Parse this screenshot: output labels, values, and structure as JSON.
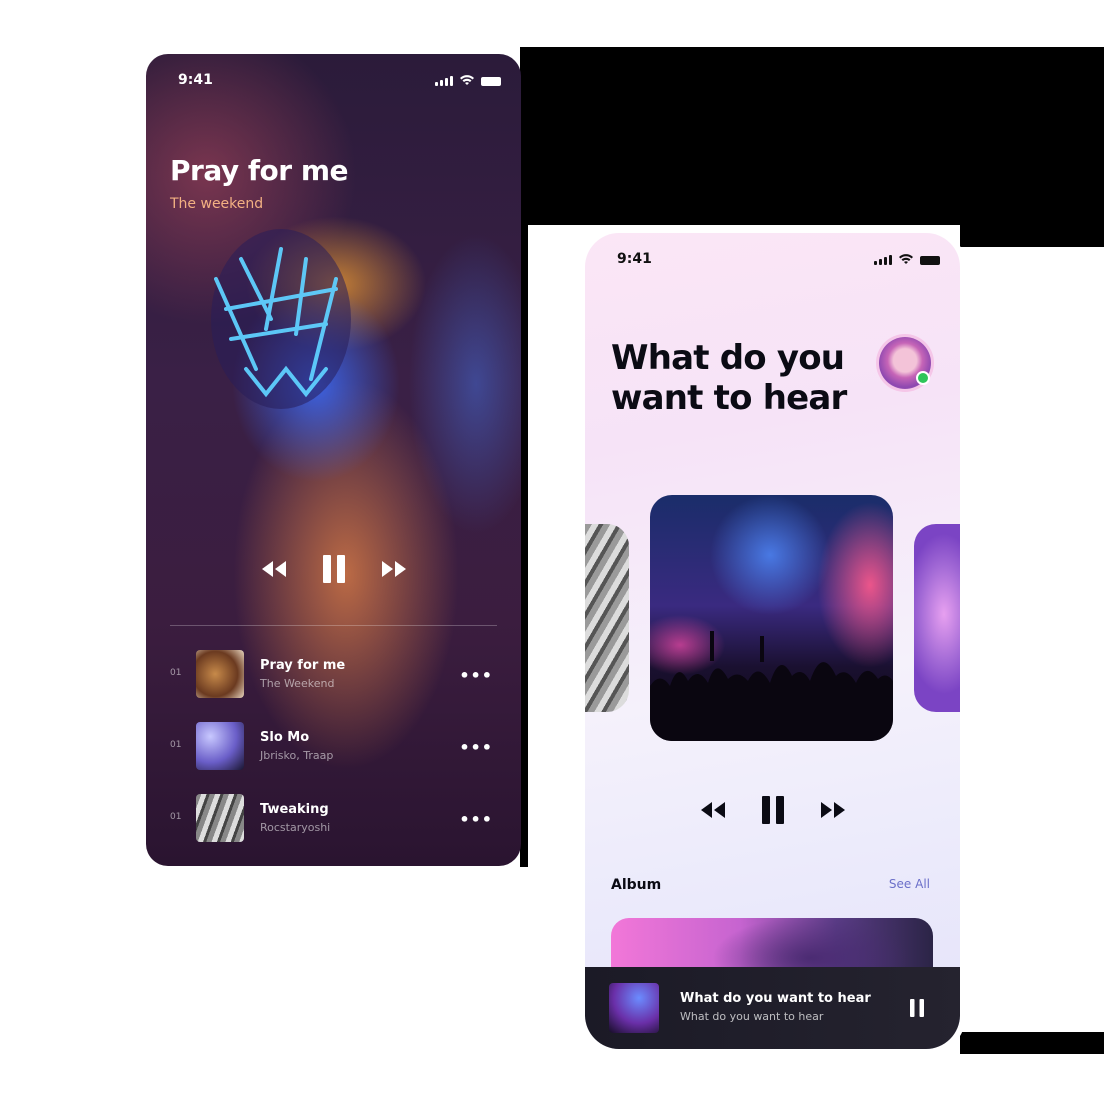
{
  "left_phone": {
    "status_time": "9:41",
    "title": "Pray for me",
    "subtitle": "The weekend",
    "tracks": [
      {
        "num": "01",
        "name": "Pray for me",
        "artist": "The Weekend",
        "more": "•••"
      },
      {
        "num": "01",
        "name": "Slo Mo",
        "artist": "Jbrisko, Traap",
        "more": "•••"
      },
      {
        "num": "01",
        "name": "Tweaking",
        "artist": "Rocstaryoshi",
        "more": "•••"
      }
    ]
  },
  "right_phone": {
    "status_time": "9:41",
    "headline": "What do you want to hear",
    "section_label": "Album",
    "see_all": "See All",
    "mini_player": {
      "title": "What do you want to hear",
      "subtitle": "What do you want to hear"
    }
  },
  "colors": {
    "accent_orange": "#f3b183",
    "link_purple": "#6b6fc9",
    "online_green": "#2ec55a"
  }
}
